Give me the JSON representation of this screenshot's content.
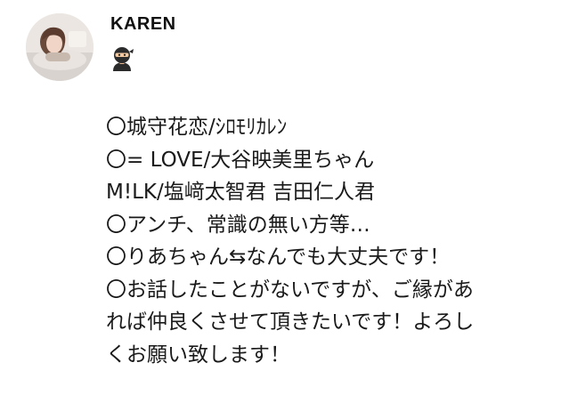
{
  "profile": {
    "username": "KAREN",
    "emoji_icon": "ninja-emoji"
  },
  "bio": {
    "lines": [
      "〇城守花恋/ｼﾛﾓﾘｶﾚﾝ",
      "〇= LOVE/大谷映美里ちゃん",
      "M!LK/塩﨑太智君 吉田仁人君",
      "〇アンチ、常識の無い方等…",
      "〇りあちゃん⇆なんでも大丈夫です！",
      "〇お話したことがないですが、ご縁があ",
      "れば仲良くさせて頂きたいです！よろし",
      "くお願い致します！"
    ]
  }
}
